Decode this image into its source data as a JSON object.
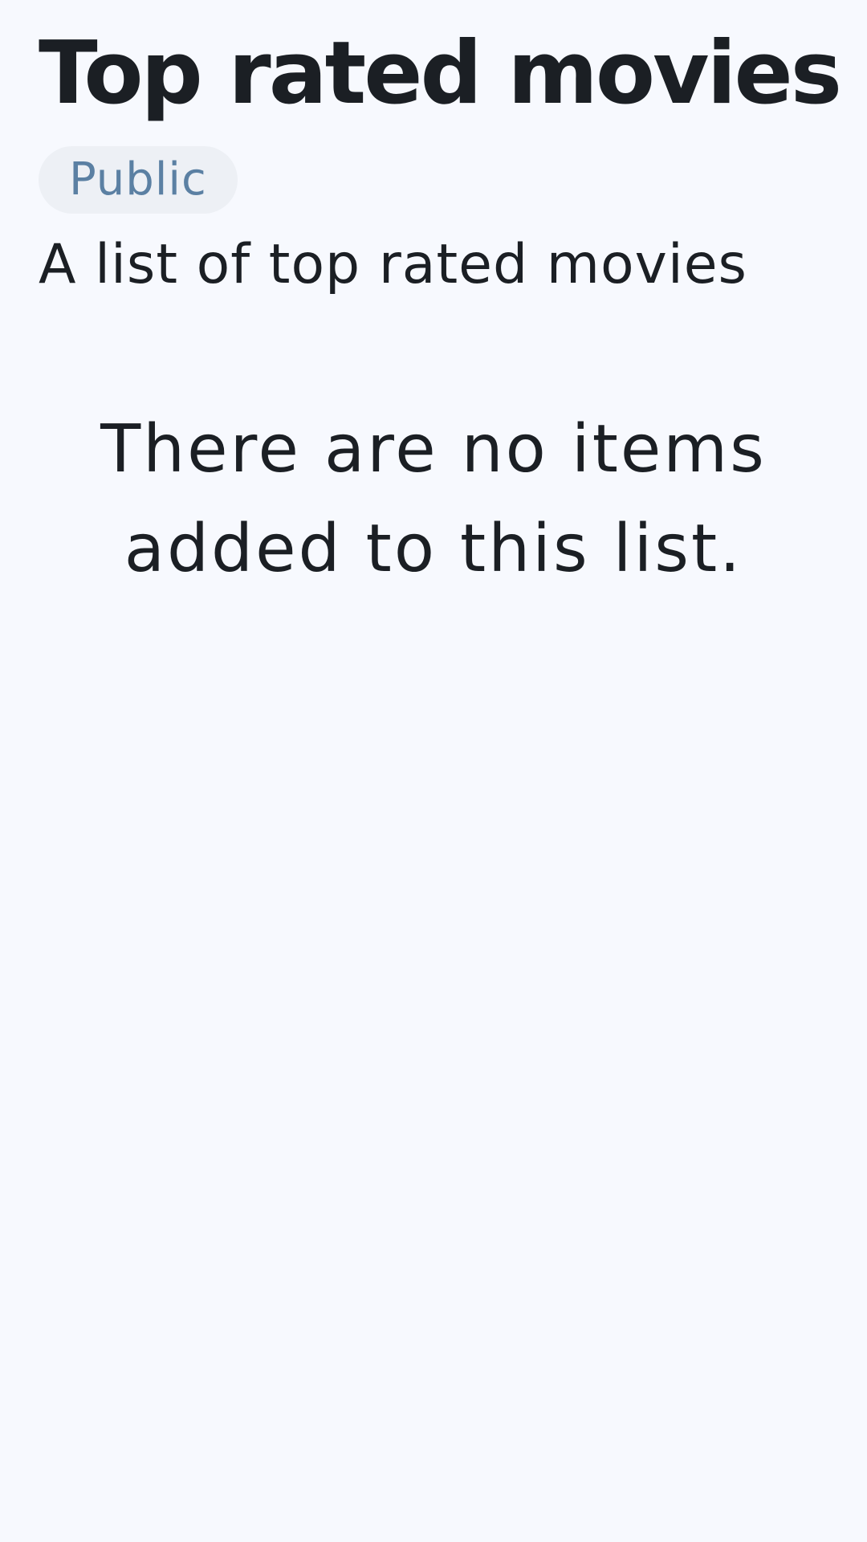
{
  "list": {
    "title": "Top rated movies",
    "visibility_badge": "Public",
    "description": "A list of top rated movies",
    "empty_message_line1": "There are no items",
    "empty_message_line2": "added to this list."
  },
  "colors": {
    "background": "#f7f9fe",
    "text": "#1b1f24",
    "badge_background": "#edf0f5",
    "badge_text": "#5b80a3"
  }
}
